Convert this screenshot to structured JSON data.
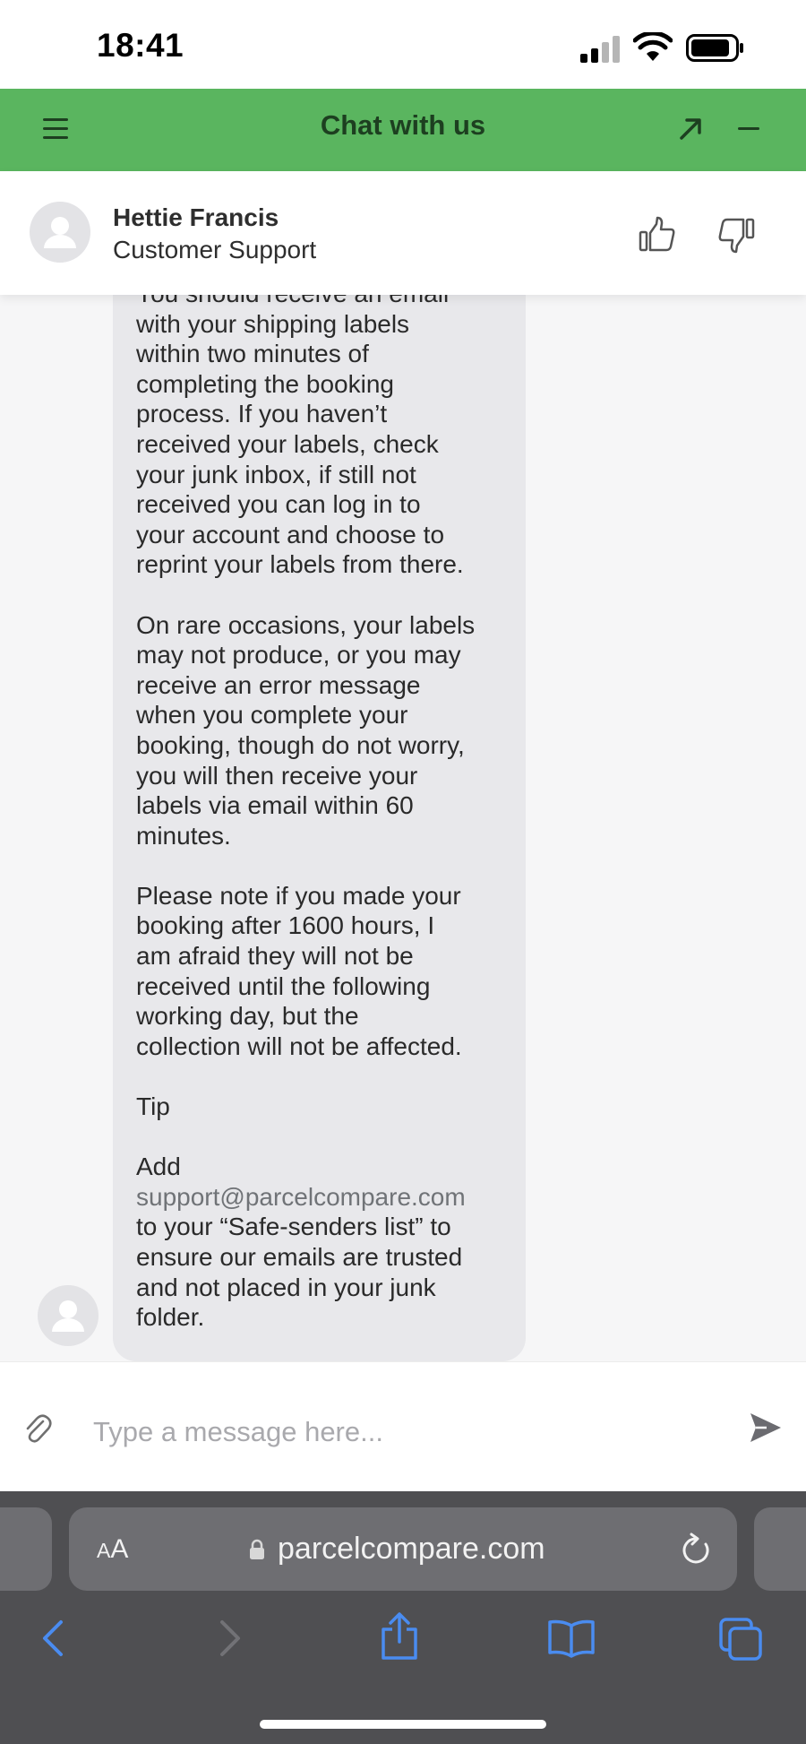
{
  "status_bar": {
    "time": "18:41"
  },
  "chat_header": {
    "title": "Chat with us",
    "accent_color": "#5ab55f"
  },
  "agent": {
    "name": "Hettie Francis",
    "role": "Customer Support"
  },
  "message": {
    "text_before_link": "You should receive an email\nwith your shipping labels\nwithin two minutes of\ncompleting the booking\nprocess. If you haven’t\nreceived your labels, check\nyour junk inbox, if still not\nreceived you can log in to\nyour account and choose to\nreprint your labels from there.\n\nOn rare occasions, your labels\nmay not produce, or you may\nreceive an error message\nwhen you complete your\nbooking, though do not worry,\nyou will then receive your\nlabels via email within 60\nminutes.\n\nPlease note if you made your\nbooking after 1600 hours, I\nam afraid they will not be\nreceived until the following\nworking day, but the\ncollection will not be affected.\n\nTip\n\nAdd\n",
    "link": "support@parcelcompare.com",
    "text_after_link": "\nto your “Safe-senders list” to\nensure our emails are trusted\nand not placed in your junk\nfolder."
  },
  "composer": {
    "placeholder": "Type a message here..."
  },
  "safari": {
    "aa_small": "A",
    "aa_large": "A",
    "url": "parcelcompare.com"
  },
  "icons": [
    "menu-icon",
    "expand-icon",
    "minimize-icon",
    "avatar-icon",
    "thumbs-up-icon",
    "thumbs-down-icon",
    "paperclip-icon",
    "send-icon",
    "lock-icon",
    "reload-icon",
    "back-icon",
    "forward-icon",
    "share-icon",
    "bookmarks-icon",
    "tabs-icon"
  ]
}
